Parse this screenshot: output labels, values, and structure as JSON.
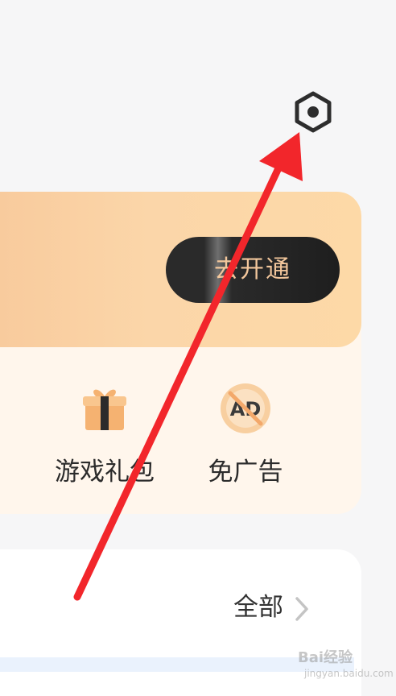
{
  "header": {
    "settings_icon": "settings-hexagon-icon"
  },
  "vip": {
    "open_button_label": "去开通",
    "colors": {
      "banner_start": "#f8c99b",
      "banner_end": "#fdd9a7",
      "button_bg": "#2a2a2a",
      "button_text": "#f3c79c"
    }
  },
  "features": [
    {
      "label": "游戏礼包",
      "icon": "gift-box-icon"
    },
    {
      "label": "免广告",
      "icon": "no-ad-icon"
    }
  ],
  "list": {
    "all_label": "全部"
  },
  "annotation": {
    "arrow_color": "#f2262b"
  },
  "watermark": {
    "brand": "Bai经验",
    "sub": "jingyan.baidu.com"
  }
}
